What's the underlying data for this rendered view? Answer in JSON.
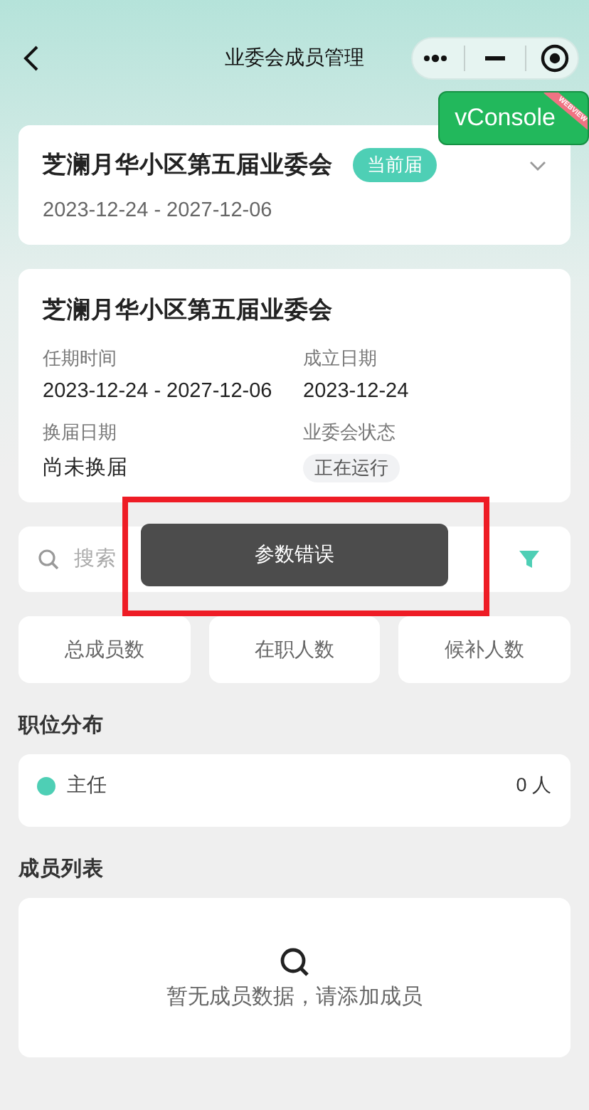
{
  "nav_bar": {
    "title": "业委会成员管理"
  },
  "debug_button": {
    "label": "vConsole",
    "ribbon": "WEBVIEW"
  },
  "term_selector": {
    "title": "芝澜月华小区第五届业委会",
    "badge": "当前届",
    "dates": "2023-12-24 - 2027-12-06",
    "expanded": false
  },
  "committee_info": {
    "title": "芝澜月华小区第五届业委会",
    "fields": [
      {
        "label": "任期时间",
        "value": "2023-12-24 - 2027-12-06",
        "kind": "text"
      },
      {
        "label": "成立日期",
        "value": "2023-12-24",
        "kind": "text"
      },
      {
        "label": "换届日期",
        "value": "尚未换届",
        "kind": "text"
      },
      {
        "label": "业委会状态",
        "value": "正在运行",
        "kind": "tag"
      }
    ]
  },
  "search": {
    "placeholder": "搜索"
  },
  "stats": [
    "总成员数",
    "在职人数",
    "候补人数"
  ],
  "position_section": {
    "title": "职位分布",
    "items": [
      {
        "name": "主任",
        "count": "0 人",
        "color": "#4ecfb5"
      }
    ]
  },
  "member_section": {
    "title": "成员列表",
    "empty_text": "暂无成员数据，请添加成员"
  },
  "toast": {
    "message": "参数错误"
  },
  "annotation": {
    "kind": "highlight"
  }
}
